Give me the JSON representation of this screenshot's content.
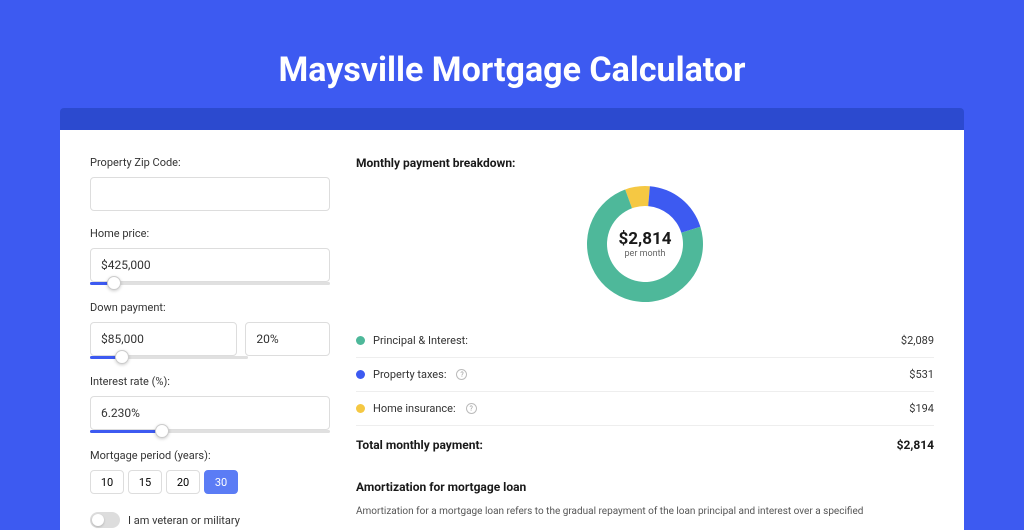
{
  "title": "Maysville Mortgage Calculator",
  "form": {
    "zip_label": "Property Zip Code:",
    "zip_value": "",
    "home_price_label": "Home price:",
    "home_price_value": "$425,000",
    "home_price_slider_pct": 10,
    "down_payment_label": "Down payment:",
    "down_payment_value": "$85,000",
    "down_payment_pct_value": "20%",
    "down_payment_slider_pct": 20,
    "interest_label": "Interest rate (%):",
    "interest_value": "6.230%",
    "interest_slider_pct": 30,
    "period_label": "Mortgage period (years):",
    "periods": [
      "10",
      "15",
      "20",
      "30"
    ],
    "period_active": "30",
    "veteran_label": "I am veteran or military"
  },
  "chart_data": {
    "type": "pie",
    "title": "Monthly payment breakdown:",
    "center_value": "$2,814",
    "center_sub": "per month",
    "series": [
      {
        "name": "Principal & Interest:",
        "value": 2089,
        "display": "$2,089",
        "color": "#4eb89a"
      },
      {
        "name": "Property taxes:",
        "value": 531,
        "display": "$531",
        "color": "#3d5af1",
        "has_info": true
      },
      {
        "name": "Home insurance:",
        "value": 194,
        "display": "$194",
        "color": "#f5c843",
        "has_info": true
      }
    ],
    "total_label": "Total monthly payment:",
    "total_value": "$2,814"
  },
  "amortization": {
    "title": "Amortization for mortgage loan",
    "text": "Amortization for a mortgage loan refers to the gradual repayment of the loan principal and interest over a specified"
  }
}
